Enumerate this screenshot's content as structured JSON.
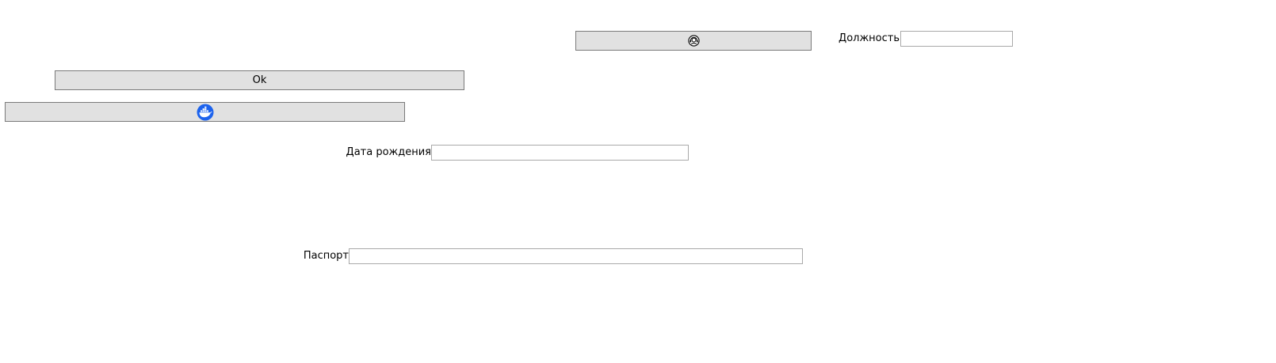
{
  "buttons": {
    "operator": {
      "icon": "operator-headset-icon"
    },
    "ok": {
      "label": "Ok"
    },
    "docker": {
      "icon": "docker-whale-icon",
      "icon_color": "#1d63ed"
    }
  },
  "fields": {
    "position": {
      "label": "Должность",
      "value": ""
    },
    "birth_date": {
      "label": "Дата рождения",
      "value": ""
    },
    "passport": {
      "label": "Паспорт",
      "value": ""
    }
  },
  "colors": {
    "button_face": "#e1e1e1",
    "button_border": "#7a7a7a",
    "input_border": "#a9a9a9"
  }
}
